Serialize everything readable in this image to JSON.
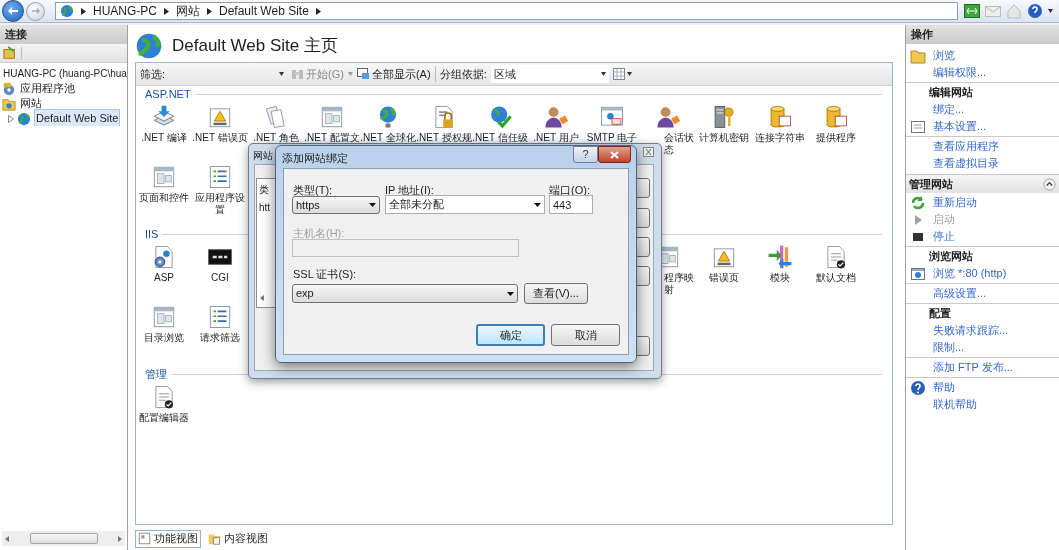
{
  "address_bar": {
    "crumbs": [
      "HUANG-PC",
      "网站",
      "Default Web Site"
    ]
  },
  "connections": {
    "title": "连接",
    "tree": [
      {
        "label": "HUANG-PC (huang-PC\\hua",
        "selected": false,
        "children": [
          {
            "label": "应用程序池",
            "kind": "pool",
            "selected": false
          },
          {
            "label": "网站",
            "kind": "sites",
            "selected": false,
            "children": [
              {
                "label": "Default Web Site",
                "kind": "site",
                "selected": true
              }
            ]
          }
        ]
      }
    ]
  },
  "page": {
    "title": "Default Web Site 主页",
    "filter": {
      "label": "筛选:",
      "go": "开始(G)",
      "show_all": "全部显示(A)",
      "group_label": "分组依据:",
      "group_value": "区域"
    },
    "groups": [
      {
        "title": "ASP.NET",
        "rows": [
          [
            {
              "label": ".NET 编译",
              "kind": "stack"
            },
            {
              "label": ".NET 错误页",
              "kind": "warning"
            },
            {
              "label": ".NET 角色",
              "kind": "pages"
            },
            {
              "label": ".NET 配置文",
              "kind": "window"
            },
            {
              "label": ".NET 全球化",
              "kind": "globe"
            },
            {
              "label": ".NET 授权规",
              "kind": "lock"
            },
            {
              "label": ".NET 信任级",
              "kind": "globecheck"
            },
            {
              "label": ".NET 用户",
              "kind": "person"
            },
            {
              "label": "SMTP 电子",
              "kind": "mail"
            },
            {
              "label": "会话状态",
              "kind": "person"
            },
            {
              "label": "计算机密钥",
              "kind": "key"
            },
            {
              "label": "连接字符串",
              "kind": "db"
            },
            {
              "label": "提供程序",
              "kind": "db"
            }
          ],
          [
            {
              "label": "页面和控件",
              "kind": "window"
            },
            {
              "label": "应用程序设置",
              "kind": "list"
            }
          ]
        ]
      },
      {
        "title": "IIS",
        "rows": [
          [
            {
              "label": "ASP",
              "kind": "gear"
            },
            {
              "label": "CGI",
              "kind": "blackbox"
            },
            {
              "label": "程序映射",
              "kind": "window"
            },
            {
              "label": "错误页",
              "kind": "warning"
            },
            {
              "label": "模块",
              "kind": "arrows"
            },
            {
              "label": "默认文档",
              "kind": "doc"
            }
          ],
          [
            {
              "label": "目录浏览",
              "kind": "window"
            },
            {
              "label": "请求筛选",
              "kind": "list"
            }
          ]
        ]
      },
      {
        "title": "管理",
        "rows": [
          [
            {
              "label": "配置编辑器",
              "kind": "doc"
            }
          ]
        ]
      }
    ]
  },
  "view_tabs": [
    {
      "label": "功能视图",
      "selected": true
    },
    {
      "label": "内容视图",
      "selected": false
    }
  ],
  "actions": {
    "title": "操作",
    "groups": [
      {
        "sections": [
          {
            "items": [
              {
                "label": "浏览",
                "kind": "folder",
                "disabled": false
              },
              {
                "label": "编辑权限...",
                "disabled": false
              }
            ]
          },
          {
            "title": "编辑网站",
            "items": [
              {
                "label": "绑定...",
                "disabled": false
              },
              {
                "label": "基本设置...",
                "kind": "settings",
                "disabled": false
              }
            ]
          },
          {
            "items": [
              {
                "label": "查看应用程序",
                "disabled": false
              },
              {
                "label": "查看虚拟目录",
                "disabled": false
              }
            ]
          }
        ]
      },
      {
        "header": "管理网站",
        "expanded": true,
        "sections": [
          {
            "items": [
              {
                "label": "重新启动",
                "kind": "restart",
                "disabled": false
              },
              {
                "label": "启动",
                "kind": "start",
                "disabled": true
              },
              {
                "label": "停止",
                "kind": "stop",
                "disabled": false
              }
            ]
          },
          {
            "title": "浏览网站",
            "items": [
              {
                "label": "浏览 *:80 (http)",
                "kind": "browse",
                "disabled": false
              }
            ]
          },
          {
            "items": [
              {
                "label": "高级设置...",
                "disabled": false
              }
            ]
          },
          {
            "title": "配置",
            "items": [
              {
                "label": "失败请求跟踪...",
                "disabled": false
              },
              {
                "label": "限制...",
                "disabled": false
              }
            ]
          },
          {
            "items": [
              {
                "label": "添加 FTP 发布...",
                "disabled": false
              }
            ]
          },
          {
            "items": [
              {
                "label": "帮助",
                "kind": "help",
                "disabled": false
              },
              {
                "label": "联机帮助",
                "disabled": false
              }
            ]
          }
        ]
      }
    ]
  },
  "bindings_dialog": {
    "title": "网站",
    "list_header": "类",
    "list_row": "htt"
  },
  "add_binding_dialog": {
    "title": "添加网站绑定",
    "help": "?",
    "type_label": "类型(T):",
    "type_value": "https",
    "ip_label": "IP 地址(I):",
    "ip_value": "全部未分配",
    "port_label": "端口(O):",
    "port_value": "443",
    "host_label": "主机名(H):",
    "host_disabled": true,
    "ssl_label": "SSL 证书(S):",
    "ssl_value": "exp",
    "view_button": "查看(V)...",
    "ok": "确定",
    "cancel": "取消"
  }
}
